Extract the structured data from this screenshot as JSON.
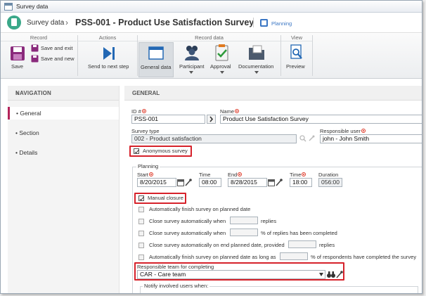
{
  "window": {
    "title": "Survey data"
  },
  "header": {
    "breadcrumb_root": "Survey data",
    "breadcrumb_sep": "›",
    "title": "PSS-001 - Product Use Satisfaction Survey",
    "planning_label": "Planning"
  },
  "ribbon": {
    "groups": {
      "record": "Record",
      "actions": "Actions",
      "record_data": "Record data",
      "view": "View"
    },
    "save": "Save",
    "save_and_exit": "Save and exit",
    "save_and_new": "Save and new",
    "send_next_step": "Send to next step",
    "general_data": "General data",
    "participant": "Participant",
    "approval": "Approval",
    "documentation": "Documentation",
    "preview": "Preview"
  },
  "navigation": {
    "title": "NAVIGATION",
    "items": [
      "General",
      "Section",
      "Details"
    ],
    "active": "General"
  },
  "general": {
    "title": "GENERAL",
    "id_label": "ID #",
    "id_value": "PSS-001",
    "name_label": "Name",
    "name_value": "Product Use Satisfaction Survey",
    "survey_type_label": "Survey type",
    "survey_type_value": "002 - Product satisfaction",
    "responsible_user_label": "Responsible user",
    "responsible_user_value": "john - John Smith",
    "anonymous_label": "Anonymous survey"
  },
  "planning": {
    "legend": "Planning",
    "start_label": "Start",
    "start_date": "8/20/2015",
    "start_time_label": "Time",
    "start_time": "08:00",
    "end_label": "End",
    "end_date": "8/28/2015",
    "end_time_label": "Time",
    "end_time": "18:00",
    "duration_label": "Duration",
    "duration": "056:00",
    "manual_closure": "Manual closure",
    "opt1": "Automatically finish survey on planned date",
    "opt2_a": "Close survey automatically when",
    "opt2_b": "replies",
    "opt3_a": "Close survey automatically when",
    "opt3_b": "% of replies has been completed",
    "opt4_a": "Close survey automatically on end planned date, provided",
    "opt4_b": "replies",
    "opt5_a": "Automatically finish survey on planned date as long as",
    "opt5_b": "% of respondents have completed the survey",
    "team_label": "Responsible team for completing",
    "team_value": "CAR - Care team",
    "notify_label": "Notify involved users when:"
  },
  "colors": {
    "accent": "#b4235a",
    "highlight": "#d6222b",
    "brand": "#3aa889",
    "link": "#3a76c4"
  }
}
